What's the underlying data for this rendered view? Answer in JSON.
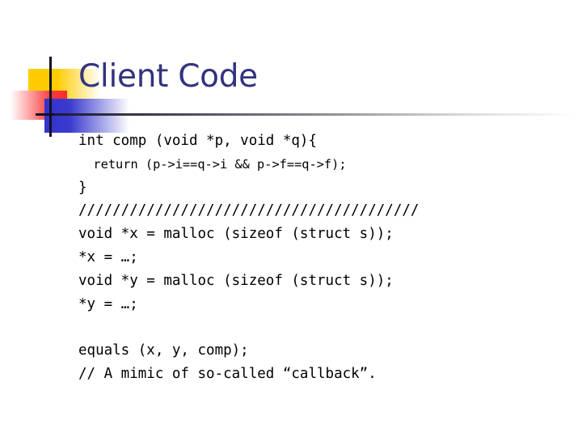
{
  "slide": {
    "title": "Client Code",
    "title_color": "#33337f",
    "background_color": "#ffffff",
    "decoration": {
      "yellow_square_color": "#ffcc00",
      "red_square_color": "#fb2b2b",
      "blue_square_color": "#3333cc",
      "crosshair_color": "#111122",
      "rule_color": "#1b1b2e"
    }
  },
  "code": {
    "language": "c",
    "lines": [
      {
        "text": "int comp (void *p, void *q){",
        "size": "normal"
      },
      {
        "text": "  return (p->i==q->i && p->f==q->f);",
        "size": "small"
      },
      {
        "text": "}",
        "size": "normal"
      },
      {
        "text": "////////////////////////////////////////",
        "size": "normal"
      },
      {
        "text": "void *x = malloc (sizeof (struct s));",
        "size": "normal"
      },
      {
        "text": "*x = …;",
        "size": "normal"
      },
      {
        "text": "void *y = malloc (sizeof (struct s));",
        "size": "normal"
      },
      {
        "text": "*y = …;",
        "size": "normal"
      },
      {
        "text": "",
        "size": "normal"
      },
      {
        "text": "equals (x, y, comp);",
        "size": "normal"
      },
      {
        "text": "// A mimic of so-called “callback”.",
        "size": "normal"
      }
    ]
  }
}
